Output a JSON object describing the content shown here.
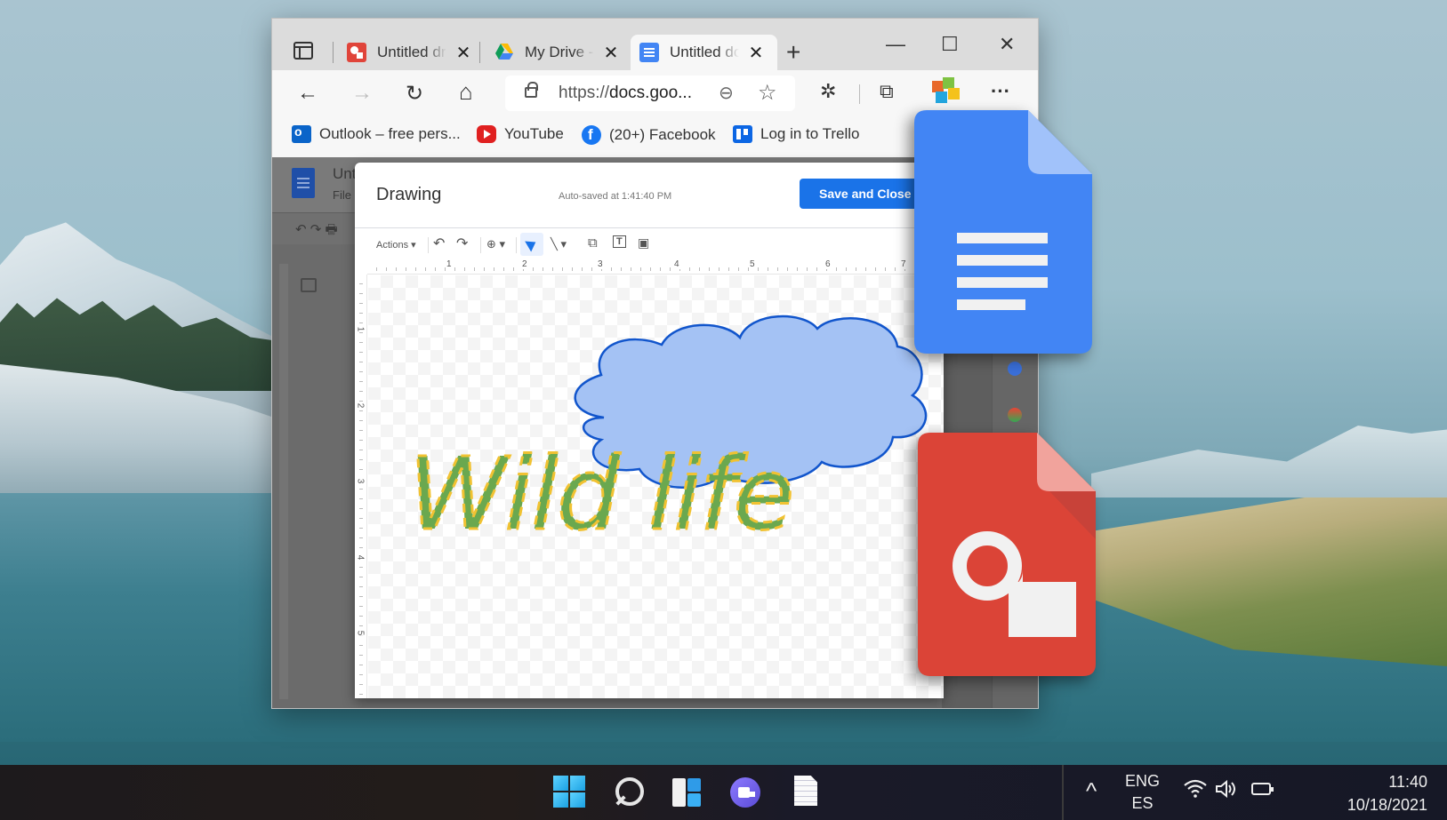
{
  "browser": {
    "tabs": [
      {
        "title": "Untitled drawing",
        "favicon": "google-drawings-icon",
        "active": false
      },
      {
        "title": "My Drive - Google Drive",
        "favicon": "google-drive-icon",
        "active": false
      },
      {
        "title": "Untitled document",
        "favicon": "google-docs-icon",
        "active": true
      }
    ],
    "new_tab": "+",
    "window_controls": {
      "minimize": "—",
      "maximize": "☐",
      "close": "✕"
    },
    "toolbar": {
      "back": "←",
      "forward": "→",
      "reload": "↻",
      "home": "⌂",
      "url_prefix": "https://",
      "url_host": "docs.goo...",
      "zoom_icon": "⊖",
      "favorite_icon": "☆",
      "extensions_icon": "✲",
      "collections_icon": "⧉",
      "more": "···"
    },
    "bookmarks": [
      {
        "label": "Outlook – free pers...",
        "icon": "outlook-icon"
      },
      {
        "label": "YouTube",
        "icon": "youtube-icon"
      },
      {
        "label": "(20+) Facebook",
        "icon": "facebook-icon"
      },
      {
        "label": "Log in to Trello",
        "icon": "trello-icon"
      }
    ]
  },
  "docs": {
    "title": "Unt",
    "menu_first": "File",
    "toolbar": "↶  ↷  🖶"
  },
  "drawing": {
    "title": "Drawing",
    "autosave": "Auto-saved at 1:41:40 PM",
    "save_button": "Save and Close",
    "toolbar": {
      "actions": "Actions ▾",
      "undo": "↶",
      "redo": "↷",
      "zoom": "⊕ ▾",
      "line": "╲ ▾",
      "shape": "⧉",
      "textbox": "T",
      "image": "▣"
    },
    "ruler_h": [
      "1",
      "2",
      "3",
      "4",
      "5",
      "6",
      "7"
    ],
    "ruler_v": [
      "1",
      "2",
      "3",
      "4",
      "5"
    ],
    "canvas_text": "Wild life",
    "colors": {
      "cloud_fill": "#a4c2f4",
      "cloud_stroke": "#1155cc",
      "text_fill": "#6aa84f",
      "text_outline": "#f1c232"
    }
  },
  "overlay_icons": [
    {
      "name": "google-docs-logo",
      "color": "#4285f4"
    },
    {
      "name": "google-drawings-logo",
      "color": "#db4437"
    }
  ],
  "taskbar": {
    "apps": [
      "Start",
      "Search",
      "Widgets",
      "Teams Chat",
      "Notepad"
    ],
    "tray_up": "^",
    "language": {
      "line1": "ENG",
      "line2": "ES"
    },
    "time": "11:40",
    "date": "10/18/2021"
  }
}
